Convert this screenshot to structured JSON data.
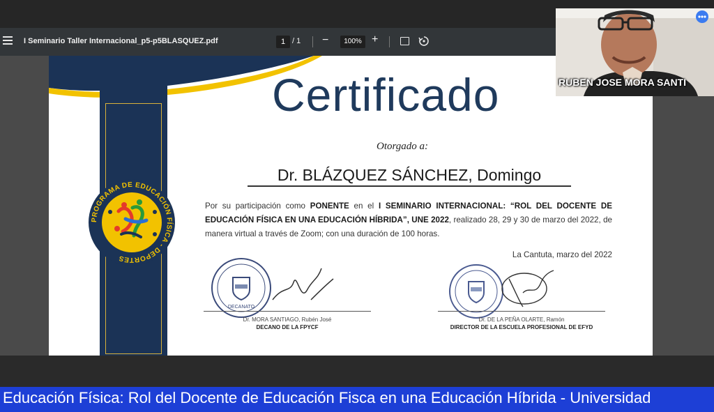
{
  "toolbar": {
    "document_title": "I Seminario Taller Internacional_p5-p5BLASQUEZ.pdf",
    "current_page": "1",
    "page_total": "/ 1",
    "zoom_out": "−",
    "zoom_level": "100%",
    "zoom_in": "+"
  },
  "certificate": {
    "title": "Certificado",
    "awarded_to": "Otorgado a:",
    "recipient": "Dr. BLÁZQUEZ SÁNCHEZ, Domingo",
    "body": {
      "intro": "Por su participación como ",
      "role": "PONENTE",
      "mid": " en el ",
      "event": "I SEMINARIO INTERNACIONAL: “ROL DEL DOCENTE DE EDUCACIÓN FÍSICA EN UNA EDUCACIÓN HÍBRIDA”, UNE 2022",
      "details": ", realizado 28, 29 y 30 de marzo del 2022, de manera virtual a través de Zoom; con una duración de 100 horas."
    },
    "place_date": "La Cantuta, marzo del 2022",
    "logo_text": "PROGRAMA DE EDUCACIÓN FÍSICA - DEPORTES",
    "signatures": [
      {
        "name": "Dr. MORA SANTIAGO, Rubén José",
        "title": "DECANO DE LA FPYCF",
        "seal_text": "DECANATO"
      },
      {
        "name": "Dr. DE LA PEÑA OLARTE, Ramón",
        "title": "DIRECTOR DE LA ESCUELA PROFESIONAL DE EFYD",
        "seal_text": ""
      }
    ]
  },
  "webcam": {
    "participant_name": "RUBEN JOSE MORA SANTI"
  },
  "ticker": {
    "text": "Educación Física: Rol del Docente de Educación Fisca en una Educación Híbrida - Universidad"
  },
  "colors": {
    "navy": "#1b3356",
    "gold": "#f2c200",
    "title_blue": "#1f3a5c",
    "ticker_blue": "#1d3fd6",
    "toolbar": "#323639"
  }
}
